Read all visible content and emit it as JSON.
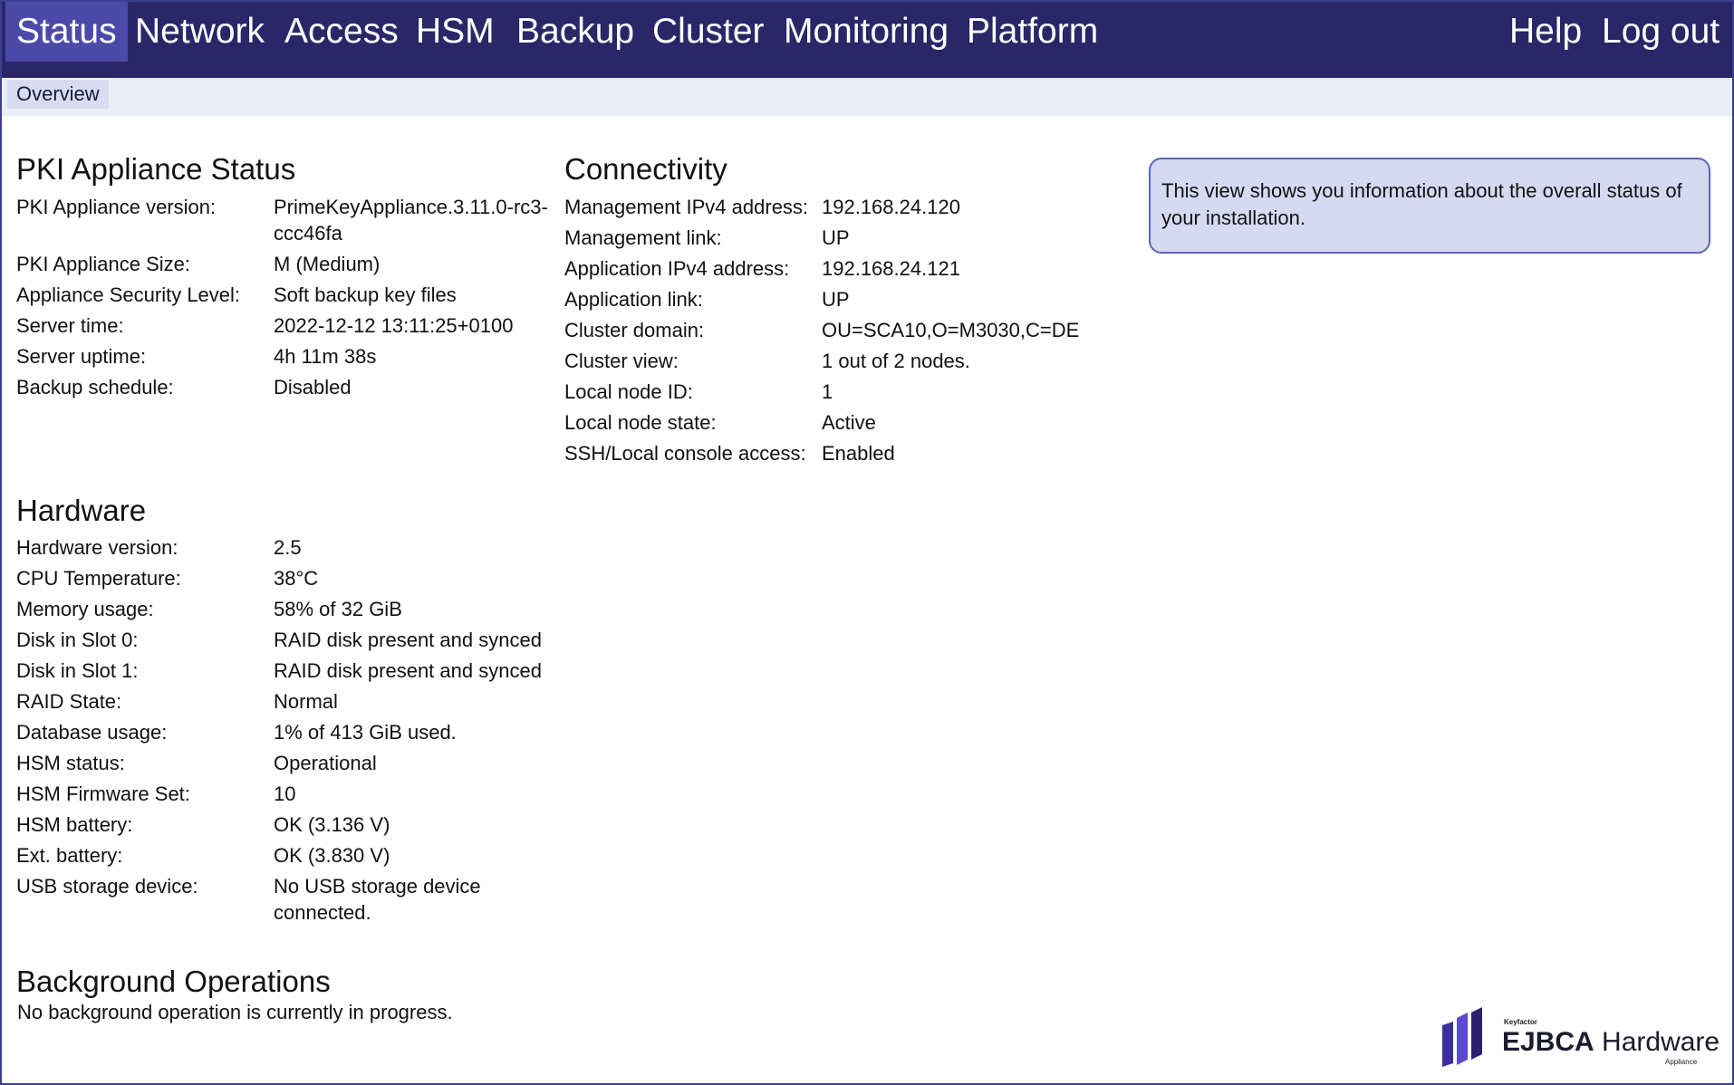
{
  "nav": {
    "items": [
      {
        "label": "Status"
      },
      {
        "label": "Network"
      },
      {
        "label": "Access"
      },
      {
        "label": "HSM"
      },
      {
        "label": "Backup"
      },
      {
        "label": "Cluster"
      },
      {
        "label": "Monitoring"
      },
      {
        "label": "Platform"
      }
    ],
    "help": "Help",
    "logout": "Log out"
  },
  "subnav": {
    "overview": "Overview"
  },
  "pki": {
    "title": "PKI Appliance Status",
    "rows": [
      {
        "k": "PKI Appliance version:",
        "v": "PrimeKeyAppliance.3.11.0-rc3-ccc46fa"
      },
      {
        "k": "PKI Appliance Size:",
        "v": "M (Medium)"
      },
      {
        "k": "Appliance Security Level:",
        "v": "Soft backup key files"
      },
      {
        "k": "Server time:",
        "v": "2022-12-12 13:11:25+0100"
      },
      {
        "k": "Server uptime:",
        "v": "4h 11m 38s"
      },
      {
        "k": "Backup schedule:",
        "v": "Disabled"
      }
    ]
  },
  "connectivity": {
    "title": "Connectivity",
    "rows": [
      {
        "k": "Management IPv4 address:",
        "v": "192.168.24.120"
      },
      {
        "k": "Management link:",
        "v": "UP"
      },
      {
        "k": "Application IPv4 address:",
        "v": "192.168.24.121"
      },
      {
        "k": "Application link:",
        "v": "UP"
      },
      {
        "k": "Cluster domain:",
        "v": "OU=SCA10,O=M3030,C=DE"
      },
      {
        "k": "Cluster view:",
        "v": "1 out of 2 nodes."
      },
      {
        "k": "Local node ID:",
        "v": "1"
      },
      {
        "k": "Local node state:",
        "v": "Active"
      },
      {
        "k": "SSH/Local console access:",
        "v": "Enabled"
      }
    ]
  },
  "info": "This view shows you information about the overall status of your installation.",
  "hardware": {
    "title": "Hardware",
    "rows": [
      {
        "k": "Hardware version:",
        "v": "2.5"
      },
      {
        "k": "CPU Temperature:",
        "v": "38°C"
      },
      {
        "k": "Memory usage:",
        "v": "58% of 32 GiB"
      },
      {
        "k": "Disk in Slot 0:",
        "v": "RAID disk present and synced"
      },
      {
        "k": "Disk in Slot 1:",
        "v": "RAID disk present and synced"
      },
      {
        "k": "RAID State:",
        "v": "Normal"
      },
      {
        "k": "Database usage:",
        "v": "1% of 413 GiB used."
      },
      {
        "k": "HSM status:",
        "v": "Operational"
      },
      {
        "k": "HSM Firmware Set:",
        "v": "10"
      },
      {
        "k": "HSM battery:",
        "v": "OK (3.136 V)"
      },
      {
        "k": "Ext. battery:",
        "v": "OK (3.830 V)"
      },
      {
        "k": "USB storage device:",
        "v": "No USB storage device connected."
      }
    ]
  },
  "background": {
    "title": "Background Operations",
    "text": "No background operation is currently in progress."
  },
  "logo": {
    "small": "Keyfactor",
    "brand_bold": "EJBCA",
    "brand_light": " Hardware",
    "sub": "Appliance",
    "colors": [
      "#3a2f9a",
      "#5a4bd0",
      "#2a2170"
    ]
  }
}
